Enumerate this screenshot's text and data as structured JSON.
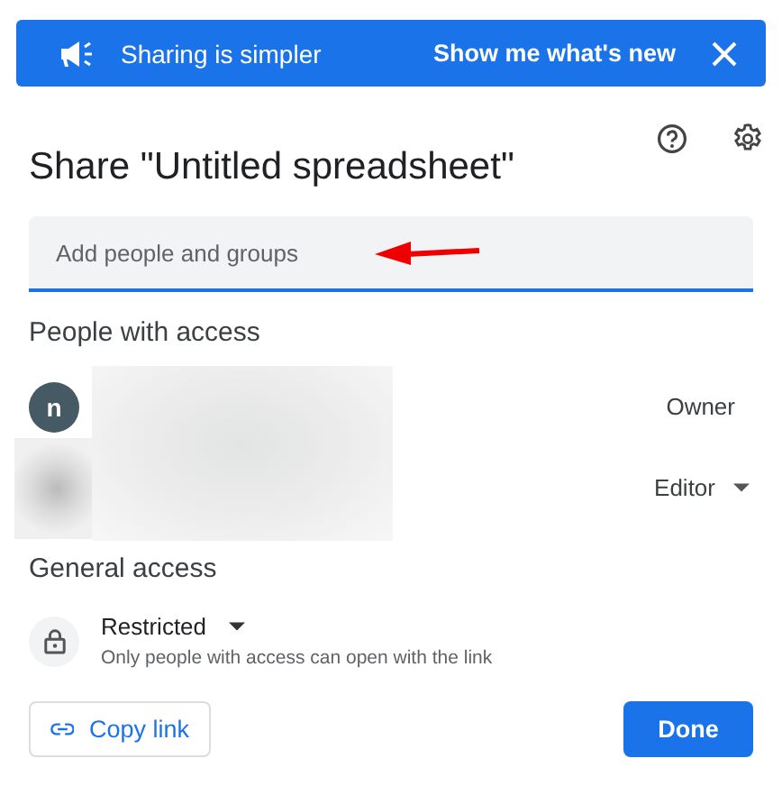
{
  "banner": {
    "text": "Sharing is simpler",
    "action": "Show me what's new"
  },
  "title": "Share \"Untitled spreadsheet\"",
  "add_field": {
    "placeholder": "Add people and groups"
  },
  "people_section": {
    "heading": "People with access",
    "people": [
      {
        "avatar": "n",
        "role": "Owner",
        "dropdown": false
      },
      {
        "role": "Editor",
        "dropdown": true
      }
    ]
  },
  "general_access": {
    "heading": "General access",
    "level": "Restricted",
    "description": "Only people with access can open with the link"
  },
  "buttons": {
    "copy_link": "Copy link",
    "done": "Done"
  }
}
